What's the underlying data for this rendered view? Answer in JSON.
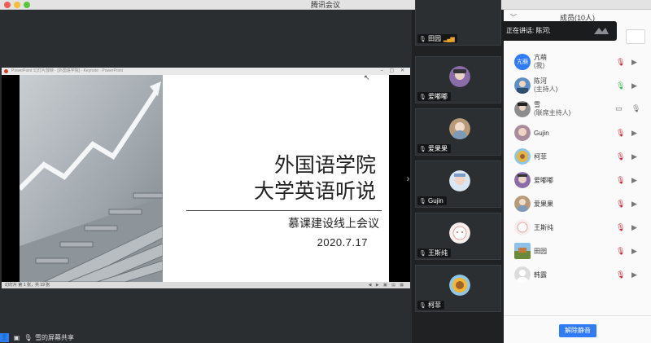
{
  "window": {
    "title": "腾讯会议"
  },
  "presentation": {
    "app_bar_text": "PowerPoint 幻灯片放映 - [外国语学院] - Keynote · PowerPoint",
    "window_controls": "– ▢ ✕",
    "slide": {
      "title_line1": "外国语学院",
      "title_line2": "大学英语听说",
      "subtitle": "慕课建设线上会议",
      "date": "2020.7.17"
    },
    "status_text": "幻灯片 第 1 张，共 19 张",
    "status_controls": "◀ ▶ ▣ ▤ ▦"
  },
  "share_bar": {
    "label": "雪的屏幕共享"
  },
  "video_tiles": [
    {
      "name": "田园",
      "avatar_color": "#6b7f9a"
    },
    {
      "name": "爱嘟嘟",
      "avatar_color": "#8a6ca8"
    },
    {
      "name": "爱果果",
      "avatar_color": "#b69a7a"
    },
    {
      "name": "Gujin",
      "avatar_color": "#7a9ccb"
    },
    {
      "name": "王斯纯",
      "avatar_color": "#f4e6e6"
    },
    {
      "name": "柯菲",
      "avatar_color": "#e4b64a"
    }
  ],
  "panel": {
    "title": "成员(10人)",
    "speaking_label": "正在讲话: 陈河;",
    "unmute_label": "解除静音",
    "members": [
      {
        "name": "亢萌",
        "role": "(我)",
        "avatar_text": "亢萌",
        "avatar_color": "#2f7cf6",
        "mic": "muted"
      },
      {
        "name": "陈河",
        "role": "(主持人)",
        "avatar_text": "",
        "avatar_color": "#5d8fc2",
        "mic": "on"
      },
      {
        "name": "雪",
        "role": "(联席主持人)",
        "avatar_text": "",
        "avatar_color": "#8c8c8c",
        "mic": "screen"
      },
      {
        "name": "Gujin",
        "role": "",
        "avatar_text": "",
        "avatar_color": "#a98c9b",
        "mic": "muted"
      },
      {
        "name": "柯菲",
        "role": "",
        "avatar_text": "",
        "avatar_color": "#e4b64a",
        "mic": "muted"
      },
      {
        "name": "爱嘟嘟",
        "role": "",
        "avatar_text": "",
        "avatar_color": "#8a6ca8",
        "mic": "muted"
      },
      {
        "name": "爱果果",
        "role": "",
        "avatar_text": "",
        "avatar_color": "#b69a7a",
        "mic": "muted"
      },
      {
        "name": "王斯纯",
        "role": "",
        "avatar_text": "",
        "avatar_color": "#f1d8d8",
        "mic": "muted"
      },
      {
        "name": "田园",
        "role": "",
        "avatar_text": "",
        "avatar_color": "#6b7f9a",
        "mic": "muted"
      },
      {
        "name": "韩露",
        "role": "",
        "avatar_text": "",
        "avatar_color": "#cfcfcf",
        "mic": "muted"
      }
    ]
  },
  "colors": {
    "accent": "#2f7cf6",
    "muted_red": "#cc2233",
    "active_green": "#3bb54a"
  }
}
